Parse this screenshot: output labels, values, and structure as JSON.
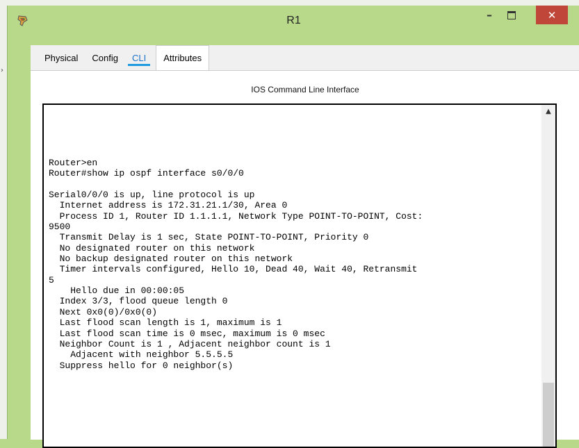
{
  "window": {
    "title": "R1",
    "controls": {
      "minimize": "–",
      "close": "✕"
    }
  },
  "tabs": [
    "Physical",
    "Config",
    "CLI",
    "Attributes"
  ],
  "active_tab": "CLI",
  "cli_title": "IOS Command Line Interface",
  "terminal_text": "Router>en\nRouter#show ip ospf interface s0/0/0\n\nSerial0/0/0 is up, line protocol is up\n  Internet address is 172.31.21.1/30, Area 0\n  Process ID 1, Router ID 1.1.1.1, Network Type POINT-TO-POINT, Cost:\n9500\n  Transmit Delay is 1 sec, State POINT-TO-POINT, Priority 0\n  No designated router on this network\n  No backup designated router on this network\n  Timer intervals configured, Hello 10, Dead 40, Wait 40, Retransmit\n5\n    Hello due in 00:00:05\n  Index 3/3, flood queue length 0\n  Next 0x0(0)/0x0(0)\n  Last flood scan length is 1, maximum is 1\n  Last flood scan time is 0 msec, maximum is 0 msec\n  Neighbor Count is 1 , Adjacent neighbor count is 1\n    Adjacent with neighbor 5.5.5.5\n  Suppress hello for 0 neighbor(s)",
  "icons": {
    "app": "packet-tracer-router-icon",
    "scroll_up": "▲"
  },
  "colors": {
    "titlebar": "#b8d98a",
    "close_button": "#c0463a",
    "active_tab": "#1a73c8",
    "active_tab_underline": "#1a9be0"
  }
}
